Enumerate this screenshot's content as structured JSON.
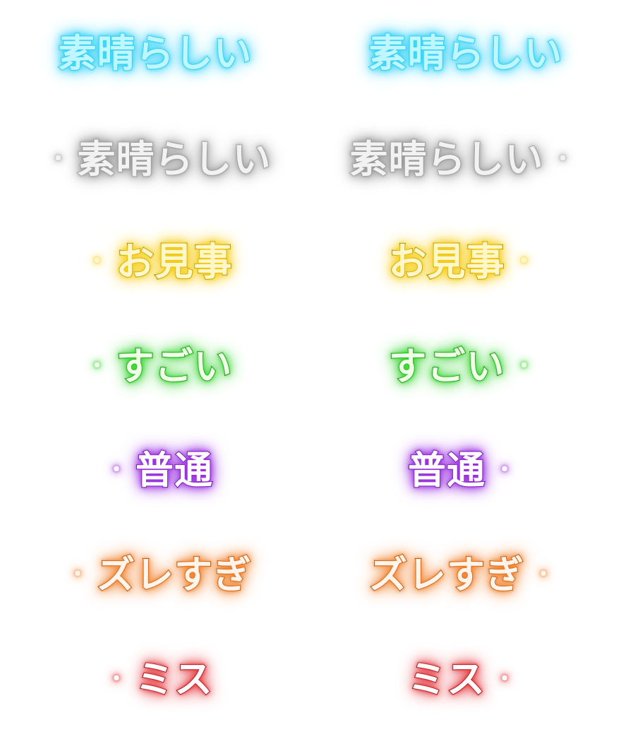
{
  "judgments": [
    {
      "key": "marvelous",
      "left": {
        "text": "素晴らしい",
        "dot": ""
      },
      "right": {
        "text": "素晴らしい",
        "dot": ""
      },
      "fill": "#bff6ff",
      "glow": "#38d2f5",
      "stroke": "#38d2f5"
    },
    {
      "key": "marvelous-side",
      "left": {
        "text": "素晴らしい",
        "dot": "・"
      },
      "right": {
        "text": "素晴らしい",
        "dot": "・"
      },
      "fill": "#f2f2f2",
      "glow": "#9a9a9a",
      "stroke": "#bdbdbd"
    },
    {
      "key": "perfect",
      "left": {
        "text": "お見事",
        "dot": "・"
      },
      "right": {
        "text": "お見事",
        "dot": "・"
      },
      "fill": "#fff7cc",
      "glow": "#f5cc12",
      "stroke": "#4a3a00"
    },
    {
      "key": "great",
      "left": {
        "text": "すごい",
        "dot": "・"
      },
      "right": {
        "text": "すごい",
        "dot": "・"
      },
      "fill": "#f2ffe8",
      "glow": "#2fd22a",
      "stroke": "#1f4a16"
    },
    {
      "key": "good",
      "left": {
        "text": "普通",
        "dot": "・"
      },
      "right": {
        "text": "普通",
        "dot": "・"
      },
      "fill": "#ffffff",
      "glow": "#9a2de0",
      "stroke": "#22102e"
    },
    {
      "key": "bad",
      "left": {
        "text": "ズレすぎ",
        "dot": "・"
      },
      "right": {
        "text": "ズレすぎ",
        "dot": "・"
      },
      "fill": "#fff5ec",
      "glow": "#ef7b22",
      "stroke": "#7a3a10"
    },
    {
      "key": "miss",
      "left": {
        "text": "ミス",
        "dot": "・"
      },
      "right": {
        "text": "ミス",
        "dot": "・"
      },
      "fill": "#ffffff",
      "glow": "#e0282e",
      "stroke": "#5a0a0c"
    }
  ]
}
